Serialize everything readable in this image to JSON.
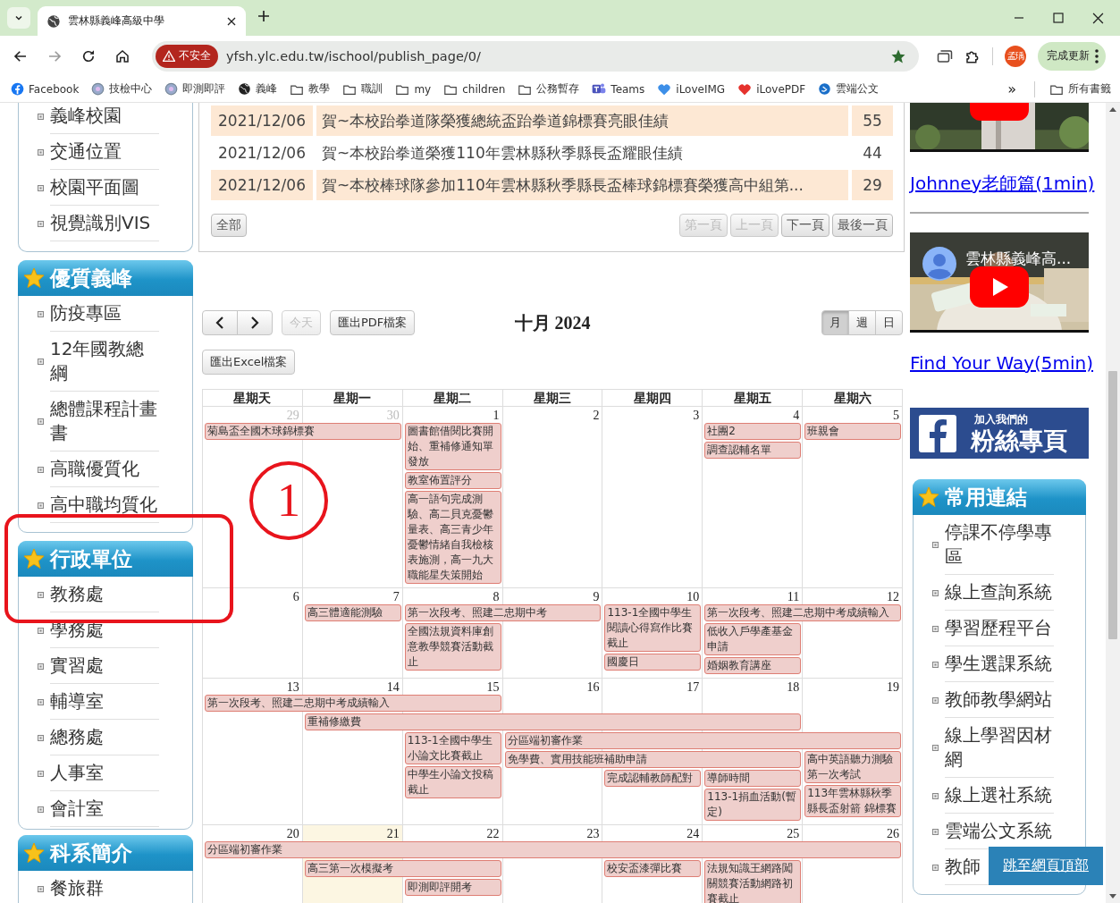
{
  "browser": {
    "tab_title": "雲林縣義峰高級中學",
    "security_label": "不安全",
    "url": "yfsh.ylc.edu.tw/ischool/publish_page/0/",
    "profile": "孟瑀",
    "update_button": "完成更新",
    "bookmarks": [
      {
        "label": "Facebook",
        "kind": "facebook"
      },
      {
        "label": "技檢中心",
        "kind": "site"
      },
      {
        "label": "即測即評",
        "kind": "site"
      },
      {
        "label": "義峰",
        "kind": "globe"
      },
      {
        "label": "教學",
        "kind": "folder"
      },
      {
        "label": "職訓",
        "kind": "folder"
      },
      {
        "label": "my",
        "kind": "folder"
      },
      {
        "label": "children",
        "kind": "folder"
      },
      {
        "label": "公務暫存",
        "kind": "folder"
      },
      {
        "label": "Teams",
        "kind": "teams"
      },
      {
        "label": "iLoveIMG",
        "kind": "heart_blue"
      },
      {
        "label": "iLovePDF",
        "kind": "heart_red"
      },
      {
        "label": "雲端公文",
        "kind": "site_blue"
      }
    ],
    "more_bookmarks": "»",
    "all_bookmarks": "所有書籤"
  },
  "sidebar": {
    "panels": [
      {
        "items": [
          "義峰校園",
          "交通位置",
          "校園平面圖",
          "視覺識別VIS"
        ]
      },
      {
        "title": "優質義峰",
        "items": [
          "防疫專區",
          "12年國教總綱",
          "總體課程計畫書",
          "高職優質化",
          "高中職均質化"
        ]
      },
      {
        "title": "行政單位",
        "items": [
          "教務處",
          "學務處",
          "實習處",
          "輔導室",
          "總務處",
          "人事室",
          "會計室"
        ]
      },
      {
        "title": "科系簡介",
        "items": [
          "餐旅群"
        ]
      }
    ]
  },
  "news": {
    "rows": [
      {
        "date": "2021/12/06",
        "title": "賀~本校跆拳道隊榮獲總統盃跆拳道錦標賽亮眼佳績",
        "count": "55"
      },
      {
        "date": "2021/12/06",
        "title": "賀~本校跆拳道榮獲110年雲林縣秋季縣長盃耀眼佳績",
        "count": "44"
      },
      {
        "date": "2021/12/06",
        "title": "賀~本校棒球隊參加110年雲林縣秋季縣長盃棒球錦標賽榮獲高中組第...",
        "count": "29"
      }
    ],
    "all_button": "全部",
    "pager": [
      {
        "label": "第一頁",
        "disabled": true
      },
      {
        "label": "上一頁",
        "disabled": true
      },
      {
        "label": "下一頁",
        "disabled": false
      },
      {
        "label": "最後一頁",
        "disabled": false
      }
    ]
  },
  "calendar": {
    "today_button": {
      "label": "今天",
      "disabled": true
    },
    "export_pdf": "匯出PDF檔案",
    "export_excel": "匯出Excel檔案",
    "title": "十月 2024",
    "views": [
      {
        "label": "月",
        "selected": true
      },
      {
        "label": "週",
        "selected": false
      },
      {
        "label": "日",
        "selected": false
      }
    ],
    "weekdays": [
      "星期天",
      "星期一",
      "星期二",
      "星期三",
      "星期四",
      "星期五",
      "星期六"
    ],
    "weeks": [
      {
        "days": [
          {
            "number": "29",
            "other_month": true,
            "today": false,
            "events": [
              {
                "title": "菊島盃全國木球錦標賽"
              }
            ]
          },
          {
            "number": "30",
            "other_month": true,
            "today": false
          },
          {
            "number": "1",
            "other_month": false,
            "today": false,
            "events": [
              {
                "title": "圖書館借閱比賽開始、重補修通知單發放"
              },
              {
                "title": "教室佈置評分"
              },
              {
                "title": "高一語句完成測驗、高二貝克憂鬱量表、高三青少年憂鬱情緒自我檢核表施測，高一九大職能星失策開始"
              }
            ]
          },
          {
            "number": "2",
            "other_month": false,
            "today": false
          },
          {
            "number": "3",
            "other_month": false,
            "today": false
          },
          {
            "number": "4",
            "other_month": false,
            "today": false,
            "events": [
              {
                "title": "社團2"
              },
              {
                "title": "調查認輔名單"
              }
            ]
          },
          {
            "number": "5",
            "other_month": false,
            "today": false,
            "events": [
              {
                "title": "班親會"
              }
            ]
          }
        ]
      },
      {
        "days": [
          {
            "number": "6",
            "other_month": false,
            "today": false
          },
          {
            "number": "7",
            "other_month": false,
            "today": false,
            "events": [
              {
                "title": "高三體適能測驗"
              }
            ]
          },
          {
            "number": "8",
            "other_month": false,
            "today": false,
            "events": [
              {
                "title": "第一次段考、照建二忠期中考"
              },
              {
                "title": "全國法規資料庫創意教學競賽活動截止"
              }
            ]
          },
          {
            "number": "9",
            "other_month": false,
            "today": false
          },
          {
            "number": "10",
            "other_month": false,
            "today": false,
            "events": [
              {
                "title": "113-1全國中學生閱讀心得寫作比賽截止"
              },
              {
                "title": "國慶日"
              }
            ]
          },
          {
            "number": "11",
            "other_month": false,
            "today": false,
            "events": [
              {
                "title": "第一次段考、照建二忠期中考成績輸入"
              },
              {
                "title": "低收入戶學產基金申請"
              },
              {
                "title": "婚姻教育講座"
              }
            ]
          },
          {
            "number": "12",
            "other_month": false,
            "today": false
          }
        ]
      },
      {
        "days": [
          {
            "number": "13",
            "other_month": false,
            "today": false,
            "events": [
              {
                "title": "第一次段考、照建二忠期中考成績輸入"
              }
            ]
          },
          {
            "number": "14",
            "other_month": false,
            "today": false,
            "events": [
              {
                "title": "重補修繳費"
              }
            ]
          },
          {
            "number": "15",
            "other_month": false,
            "today": false,
            "events": [
              {
                "title": "113-1全國中學生小論文比賽截止"
              },
              {
                "title": "中學生小論文投稿截止"
              }
            ]
          },
          {
            "number": "16",
            "other_month": false,
            "today": false,
            "events": [
              {
                "title": "分區端初審作業"
              },
              {
                "title": "免學費、實用技能班補助申請"
              }
            ]
          },
          {
            "number": "17",
            "other_month": false,
            "today": false,
            "events": [
              {
                "title": "完成認輔教師配對"
              }
            ]
          },
          {
            "number": "18",
            "other_month": false,
            "today": false,
            "events": [
              {
                "title": "導師時間"
              },
              {
                "title": "113-1捐血活動(暫定)"
              }
            ]
          },
          {
            "number": "19",
            "other_month": false,
            "today": false,
            "events": [
              {
                "title": "高中英語聽力測驗第一次考試"
              },
              {
                "title": "113年雲林縣秋季縣長盃射箭 錦標賽"
              }
            ]
          }
        ]
      },
      {
        "days": [
          {
            "number": "20",
            "other_month": false,
            "today": false,
            "events": [
              {
                "title": "分區端初審作業"
              }
            ]
          },
          {
            "number": "21",
            "other_month": false,
            "today": true,
            "events": [
              {
                "title": "高三第一次模擬考"
              }
            ]
          },
          {
            "number": "22",
            "other_month": false,
            "today": false,
            "events": [
              {
                "title": "即測即評開考"
              }
            ]
          },
          {
            "number": "23",
            "other_month": false,
            "today": false
          },
          {
            "number": "24",
            "other_month": false,
            "today": false,
            "events": [
              {
                "title": "校安盃漆彈比賽"
              }
            ]
          },
          {
            "number": "25",
            "other_month": false,
            "today": false,
            "events": [
              {
                "title": "法規知識王網路闖關競賽活動網路初賽截止"
              }
            ]
          },
          {
            "number": "26",
            "other_month": false,
            "today": false
          }
        ]
      }
    ]
  },
  "right": {
    "videos": [
      {
        "kind": "picture",
        "link": "Johnney老師篇(1min)"
      },
      {
        "kind": "picture",
        "overlay_title": "雲林縣義峰高...",
        "link": "Find Your Way(5min)"
      }
    ],
    "facebook_banner": {
      "subtitle": "加入我們的",
      "title": "粉絲專頁"
    },
    "links_panel": {
      "title": "常用連結",
      "items": [
        "停課不停學專區",
        "線上查詢系統",
        "學習歷程平台",
        "學生選課系統",
        "教師教學網站",
        "線上學習因材網",
        "線上選社系統",
        "雲端公文系統",
        "教師"
      ]
    }
  },
  "jump_button": "跳至網頁頂部",
  "annotations": [
    {
      "kind": "circle",
      "label": "1"
    },
    {
      "kind": "box"
    }
  ]
}
